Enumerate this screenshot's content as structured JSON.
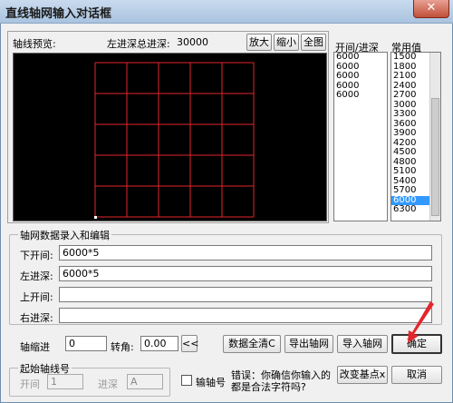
{
  "window": {
    "title": "直线轴网输入对话框",
    "close_glyph": "✕"
  },
  "preview": {
    "label": "轴线预览:",
    "total_depth_label": "左进深总进深:",
    "total_depth_value": "30000",
    "buttons": {
      "zoom_in": "放大",
      "zoom_out": "缩小",
      "full_view": "全图"
    },
    "grid": {
      "cols": 5,
      "rows": 5,
      "line_color": "#e4252c",
      "marker_color": "#ffffff"
    }
  },
  "bays_list": {
    "header": "开间/进深",
    "items": [
      "6000",
      "6000",
      "6000",
      "6000",
      "6000"
    ]
  },
  "common_values": {
    "header": "常用值",
    "items": [
      "1500",
      "1800",
      "2100",
      "2400",
      "2700",
      "3000",
      "3300",
      "3600",
      "3900",
      "4200",
      "4500",
      "4800",
      "5100",
      "5400",
      "5700",
      "6000",
      "6300"
    ],
    "selected": "6000"
  },
  "data_entry": {
    "group_title": "轴网数据录入和编辑",
    "rows": [
      {
        "label": "下开间:",
        "value": "6000*5"
      },
      {
        "label": "左进深:",
        "value": "6000*5"
      },
      {
        "label": "上开间:",
        "value": ""
      },
      {
        "label": "右进深:",
        "value": ""
      }
    ]
  },
  "controls": {
    "indent_label": "轴缩进",
    "indent_value": "0",
    "angle_label": "转角:",
    "angle_value": "0.00",
    "angle_button": "<<",
    "clear_button": "数据全清C",
    "export_button": "导出轴网",
    "import_button": "导入轴网",
    "ok_button": "确定",
    "change_base_button": "改变基点x",
    "cancel_button": "取消"
  },
  "start_axis": {
    "group_title": "起始轴线号",
    "bay_label": "开间",
    "bay_value": "1",
    "depth_label": "进深",
    "depth_value": "A"
  },
  "axis_number_checkbox": {
    "label": "输轴号",
    "checked": false
  },
  "error_message": {
    "line1": "错误：你确信你输入的",
    "line2": "都是合法字符吗?"
  },
  "annotation": {
    "arrow_color": "#e4252c"
  }
}
